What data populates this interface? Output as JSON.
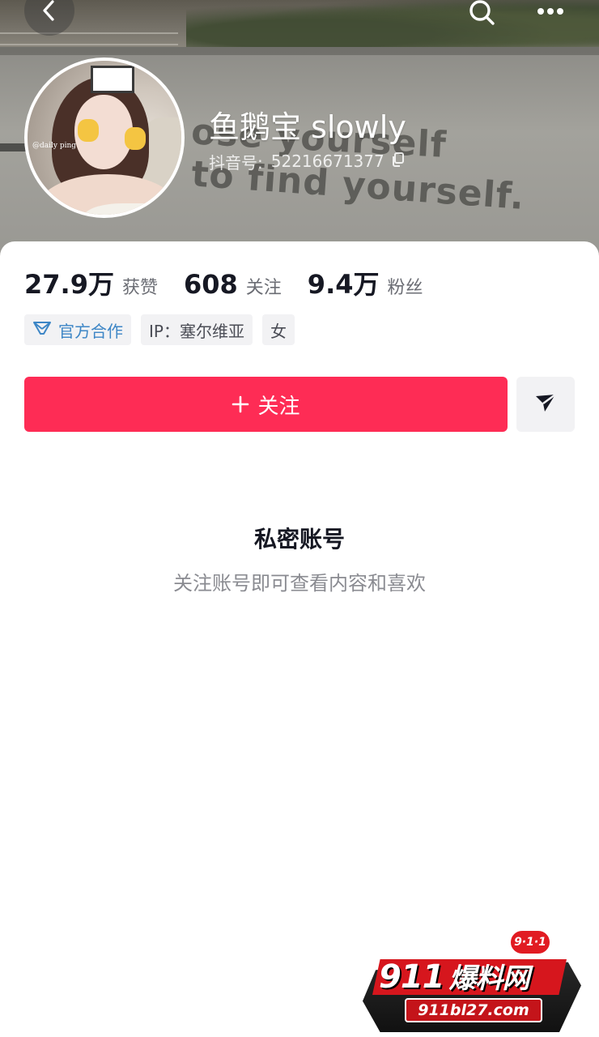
{
  "cover": {
    "wall_text_line1": "ose yourself",
    "wall_text_line2": "to find yourself."
  },
  "header": {
    "back_icon": "chevron-left-icon",
    "search_icon": "search-icon",
    "more_icon": "more-dots-icon"
  },
  "profile": {
    "nickname": "鱼鹅宝 slowly",
    "douyin_id_label": "抖音号:",
    "douyin_id": "52216671377",
    "avatar_watermark": "@daily ping"
  },
  "stats": [
    {
      "value": "27.9万",
      "label": "获赞"
    },
    {
      "value": "608",
      "label": "关注"
    },
    {
      "value": "9.4万",
      "label": "粉丝"
    }
  ],
  "tags": {
    "official": "官方合作",
    "ip": "IP：塞尔维亚",
    "gender": "女"
  },
  "actions": {
    "follow_label": "关注",
    "share_icon": "send-icon"
  },
  "private": {
    "title": "私密账号",
    "subtitle": "关注账号即可查看内容和喜欢"
  },
  "watermark": {
    "badge": "9·1·1",
    "brand_number": "911",
    "brand_cn": "爆料网",
    "url": "911bl27.com"
  },
  "colors": {
    "accent": "#fe2c55",
    "official_blue": "#3d86c6",
    "text_primary": "#161823",
    "text_secondary": "#8a8b91"
  }
}
